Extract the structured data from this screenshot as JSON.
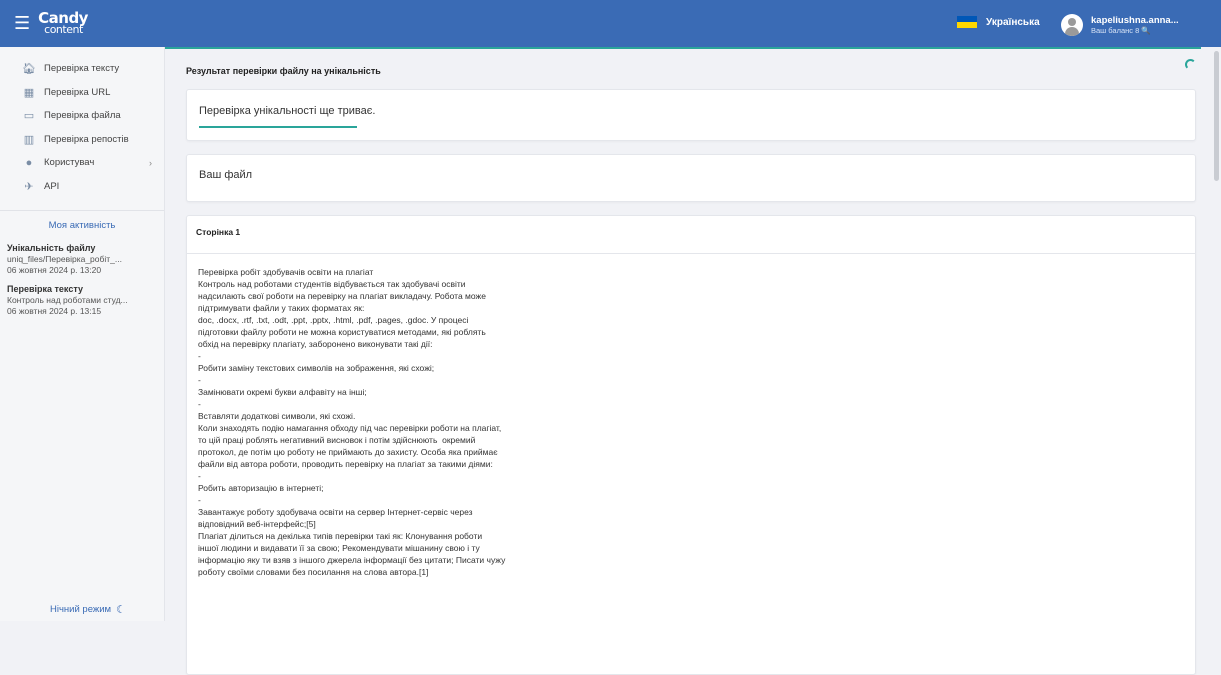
{
  "header": {
    "logo_line1": "Candy",
    "logo_line2": "content",
    "language": "Українська",
    "user_name": "kapeliushna.anna...",
    "user_balance": "Ваш баланс 8 🔍",
    "flag_colors": [
      "#0057b7",
      "#ffd700"
    ]
  },
  "sidebar": {
    "items": [
      {
        "label": "Перевірка тексту",
        "icon": "home-icon"
      },
      {
        "label": "Перевірка URL",
        "icon": "url-icon"
      },
      {
        "label": "Перевірка файла",
        "icon": "file-icon"
      },
      {
        "label": "Перевірка репостів",
        "icon": "chart-icon"
      },
      {
        "label": "Користувач",
        "icon": "user-icon"
      },
      {
        "label": "API",
        "icon": "api-icon"
      }
    ],
    "activity_title": "Моя активність",
    "activity": [
      {
        "heading": "Унікальність файлу",
        "line1": "uniq_files/Перевірка_робіт_...",
        "line2": "06 жовтня 2024 р. 13:20"
      },
      {
        "heading": "Перевірка тексту",
        "line1": "Контроль над роботами студ...",
        "line2": "06 жовтня 2024 р. 13:15"
      }
    ],
    "night_mode": "Нічний режим"
  },
  "main": {
    "page_title": "Результат перевірки файлу на унікальність",
    "status_text": "Перевірка унікальності ще триває.",
    "file_card_title": "Ваш файл",
    "page_label": "Сторінка 1",
    "lines": [
      "Перевірка робіт здобувачів освіти на плагіат",
      "Контроль над роботами студентів відбувається так здобувачі освіти",
      "надсилають свої роботи на перевірку на плагіат викладачу. Робота може",
      "підтримувати файли у таких форматах як:",
      "doc, .docx, .rtf, .txt, .odt, .ppt, .pptx, .html, .pdf, .pages, .gdoc. У процесі",
      "підготовки файлу роботи не можна користуватися методами, які роблять",
      "обхід на перевірку плагіату, заборонено виконувати такі дії:",
      "-",
      "Робити заміну текстових символів на зображення, які схожі;",
      "-",
      "Замінювати окремі букви алфавіту на інші;",
      "-",
      "Вставляти додаткові символи, які схожі.",
      "Коли знаходять подію намагання обходу під час перевірки роботи на плагіат,",
      "то цій праці роблять негативний висновок і потім здійснюють  окремий",
      "протокол, де потім цю роботу не приймають до захисту. Особа яка приймає",
      "файли від автора роботи, проводить перевірку на плагіат за такими діями:",
      "-",
      "Робить авторизацію в інтернеті;",
      "-",
      "Завантажує роботу здобувача освіти на сервер Інтернет-сервіс через",
      "відповідний веб-інтерфейс;[5]",
      "Плагіат ділиться на декілька типів перевірки такі як: Клонування роботи",
      "іншої людини и видавати її за свою; Рекомендувати мішанину свою і ту",
      "інформацію яку ти взяв з іншого джерела інформації без цитати; Писати чужу",
      "роботу своїми словами без посилання на слова автора.[1]"
    ]
  }
}
